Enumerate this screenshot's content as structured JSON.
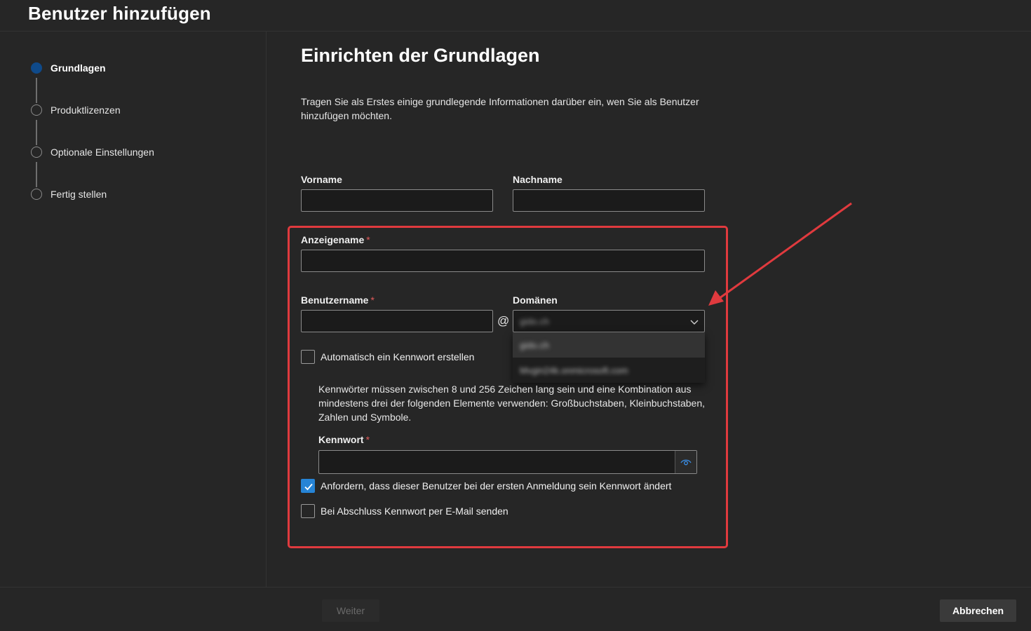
{
  "header": {
    "title": "Benutzer hinzufügen"
  },
  "steps": [
    {
      "label": "Grundlagen",
      "active": true
    },
    {
      "label": "Produktlizenzen",
      "active": false
    },
    {
      "label": "Optionale Einstellungen",
      "active": false
    },
    {
      "label": "Fertig stellen",
      "active": false
    }
  ],
  "main": {
    "title": "Einrichten der Grundlagen",
    "intro": "Tragen Sie als Erstes einige grundlegende Informationen darüber ein, wen Sie als Benutzer hinzufügen möchten."
  },
  "form": {
    "first_name": {
      "label": "Vorname",
      "value": ""
    },
    "last_name": {
      "label": "Nachname",
      "value": ""
    },
    "display_name": {
      "label": "Anzeigename",
      "required_mark": "*",
      "value": ""
    },
    "username": {
      "label": "Benutzername",
      "required_mark": "*",
      "value": ""
    },
    "at_symbol": "@",
    "domains": {
      "label": "Domänen",
      "selected": "gido.ch",
      "options": [
        "gido.ch",
        "Mvgin24k.onmicrosoft.com"
      ]
    },
    "auto_password": {
      "label": "Automatisch ein Kennwort erstellen",
      "checked": false
    },
    "password_hint": "Kennwörter müssen zwischen 8 und 256 Zeichen lang sein und eine Kombination aus mindestens drei der folgenden Elemente verwenden: Großbuchstaben, Kleinbuchstaben, Zahlen und Symbole.",
    "password": {
      "label": "Kennwort",
      "required_mark": "*",
      "value": ""
    },
    "require_change": {
      "label": "Anfordern, dass dieser Benutzer bei der ersten Anmeldung sein Kennwort ändert",
      "checked": true
    },
    "email_password": {
      "label": "Bei Abschluss Kennwort per E-Mail senden",
      "checked": false
    }
  },
  "footer": {
    "next_label": "Weiter",
    "cancel_label": "Abbrechen"
  },
  "colors": {
    "accent": "#2684d6",
    "active_step": "#0f4a8a",
    "highlight": "#e03a3e",
    "background": "#262626"
  }
}
